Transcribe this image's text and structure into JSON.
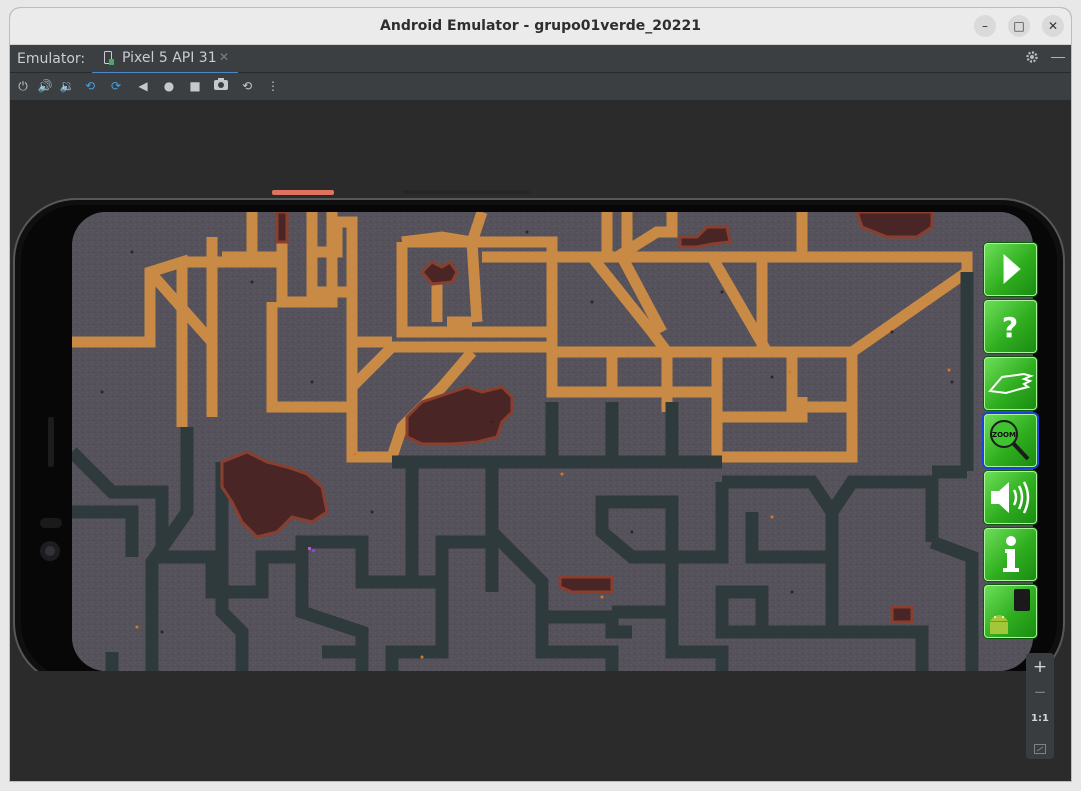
{
  "window": {
    "title": "Android Emulator - grupo01verde_20221",
    "minimize_glyph": "–",
    "maximize_glyph": "□",
    "close_glyph": "✕"
  },
  "tabbar": {
    "emulator_label": "Emulator:",
    "tab_label": "Pixel 5 API 31",
    "tab_close": "✕",
    "settings_icon": "gear-icon",
    "minimize_panel_icon": "minus-icon"
  },
  "toolbar": {
    "buttons": [
      "power-icon",
      "volume-up-icon",
      "volume-down-icon",
      "rotate-left-icon",
      "rotate-right-icon",
      "back-icon",
      "home-icon",
      "overview-icon",
      "camera-icon",
      "snapshot-icon",
      "more-icon"
    ],
    "accent": "#4a88c7"
  },
  "game": {
    "sidebar_buttons": [
      {
        "name": "play-button",
        "icon": "play-icon"
      },
      {
        "name": "help-button",
        "icon": "question-icon"
      },
      {
        "name": "hand-button",
        "icon": "hand-icon"
      },
      {
        "name": "zoom-button",
        "icon": "zoom-icon",
        "label": "ZOOM",
        "selected": true
      },
      {
        "name": "sound-button",
        "icon": "speaker-icon"
      },
      {
        "name": "info-button",
        "icon": "info-icon"
      },
      {
        "name": "android-button",
        "icon": "android-icon"
      }
    ],
    "colors": {
      "ground": "#56525b",
      "orange_tunnel": "#c98a45",
      "dark_tunnel": "#2f3a3c",
      "rock": "#4a2526",
      "button_green": "#2fae1f"
    }
  },
  "zoom_controls": {
    "plus": "+",
    "minus": "−",
    "one_to_one": "1:1"
  }
}
